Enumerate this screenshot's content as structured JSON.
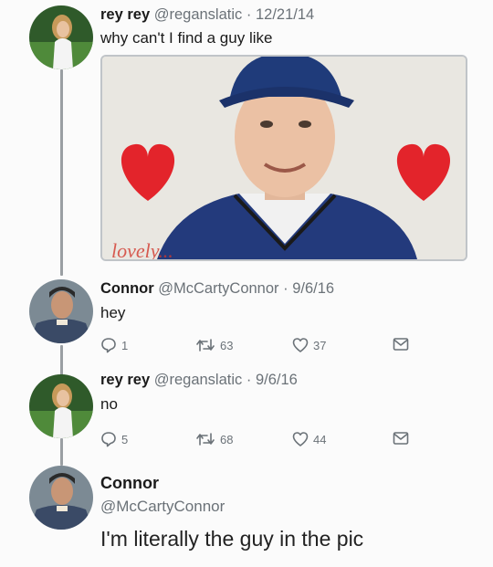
{
  "tweets": [
    {
      "name": "rey rey",
      "handle": "@reganslatic",
      "date": "12/21/14",
      "text": "why can't I find a guy like",
      "avatar": "woman-avatar",
      "photo_watermark": "lovely..."
    },
    {
      "name": "Connor",
      "handle": "@McCartyConnor",
      "date": "9/6/16",
      "text": "hey",
      "avatar": "man-avatar",
      "replies": "1",
      "retweets": "63",
      "likes": "37"
    },
    {
      "name": "rey rey",
      "handle": "@reganslatic",
      "date": "9/6/16",
      "text": "no",
      "avatar": "woman-avatar",
      "replies": "5",
      "retweets": "68",
      "likes": "44"
    },
    {
      "name": "Connor",
      "handle": "@McCartyConnor",
      "text": "I'm literally the guy in the pic",
      "avatar": "man-avatar"
    }
  ],
  "colors": {
    "thread_line": "#9a9fa3",
    "heart": "#e3242b",
    "cap": "#1f3b7a",
    "meta_gray": "#6b7278"
  },
  "icons": [
    "reply-icon",
    "retweet-icon",
    "like-icon",
    "message-icon"
  ]
}
